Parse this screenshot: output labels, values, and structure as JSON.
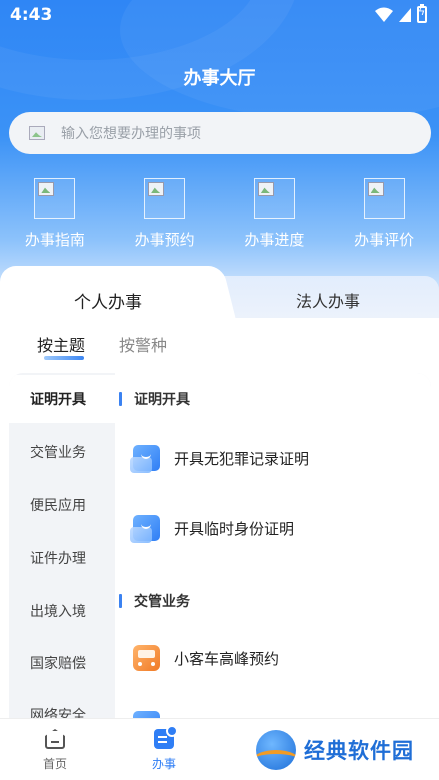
{
  "status_bar": {
    "time": "4:43"
  },
  "header": {
    "title": "办事大厅"
  },
  "search": {
    "placeholder": "输入您想要办理的事项"
  },
  "quick_actions": [
    {
      "label": "办事指南"
    },
    {
      "label": "办事预约"
    },
    {
      "label": "办事进度"
    },
    {
      "label": "办事评价"
    }
  ],
  "tabs": [
    {
      "label": "个人办事",
      "active": true
    },
    {
      "label": "法人办事",
      "active": false
    }
  ],
  "subtabs": [
    {
      "label": "按主题",
      "active": true
    },
    {
      "label": "按警种",
      "active": false
    }
  ],
  "sidebar": {
    "items": [
      {
        "label": "证明开具",
        "active": true
      },
      {
        "label": "交管业务"
      },
      {
        "label": "便民应用"
      },
      {
        "label": "证件办理"
      },
      {
        "label": "出境入境"
      },
      {
        "label": "国家赔偿"
      },
      {
        "label": "网络安全"
      }
    ]
  },
  "sections": [
    {
      "title": "证明开具",
      "services": [
        {
          "label": "开具无犯罪记录证明",
          "icon": "document-icon"
        },
        {
          "label": "开具临时身份证明",
          "icon": "document-icon"
        }
      ]
    },
    {
      "title": "交管业务",
      "services": [
        {
          "label": "小客车高峰预约",
          "icon": "bus-icon"
        }
      ]
    }
  ],
  "bottom_nav": [
    {
      "label": "首页",
      "icon": "home-icon",
      "active": false
    },
    {
      "label": "办事",
      "icon": "service-icon",
      "active": true
    }
  ],
  "watermark": {
    "text": "经典软件园"
  },
  "colors": {
    "accent": "#2f7ef5",
    "header_top": "#2f86f5",
    "bus_orange": "#f07a26"
  }
}
